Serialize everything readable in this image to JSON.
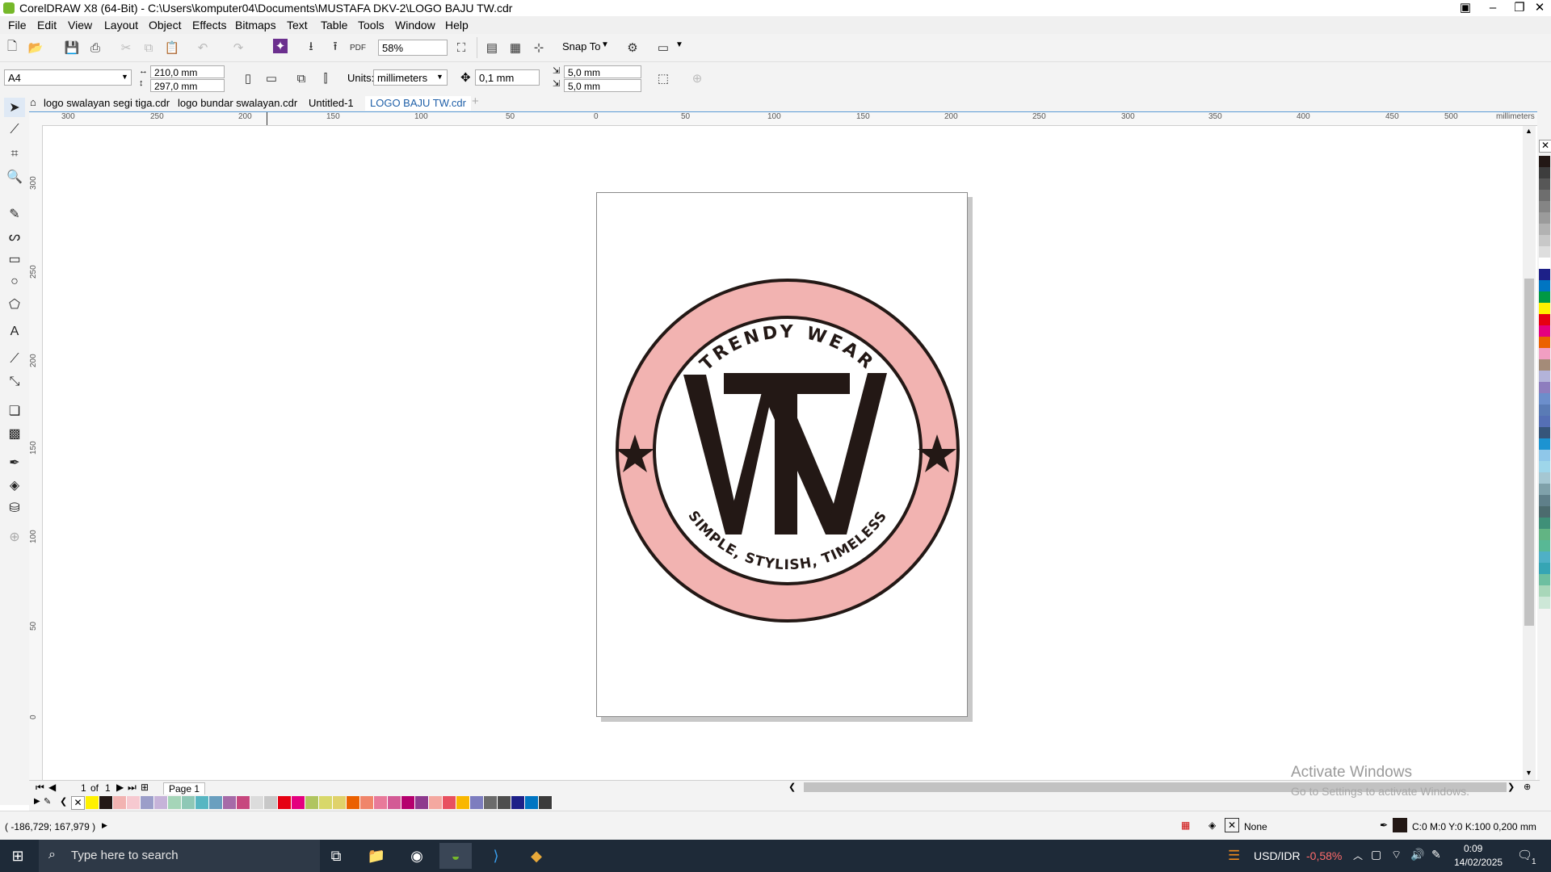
{
  "window": {
    "title": "CorelDRAW X8 (64-Bit) - C:\\Users\\komputer04\\Documents\\MUSTAFA DKV-2\\LOGO BAJU TW.cdr"
  },
  "menu": [
    "File",
    "Edit",
    "View",
    "Layout",
    "Object",
    "Effects",
    "Bitmaps",
    "Text",
    "Table",
    "Tools",
    "Window",
    "Help"
  ],
  "toolbar": {
    "zoom": "58%",
    "snap_to": "Snap To"
  },
  "property_bar": {
    "page_size": "A4",
    "width": "210,0 mm",
    "height": "297,0 mm",
    "units_label": "Units:",
    "units": "millimeters",
    "nudge": "0,1 mm",
    "dup_x": "5,0 mm",
    "dup_y": "5,0 mm"
  },
  "tabs": [
    "logo swalayan segi tiga.cdr",
    "logo bundar swalayan.cdr",
    "Untitled-1",
    "LOGO BAJU TW.cdr"
  ],
  "active_tab": "LOGO BAJU TW.cdr",
  "hruler": {
    "labels": [
      "300",
      "250",
      "200",
      "150",
      "100",
      "50",
      "0",
      "50",
      "100",
      "150",
      "200",
      "250",
      "300",
      "350",
      "400",
      "450",
      "500"
    ],
    "unit": "millimeters"
  },
  "vruler": {
    "labels": [
      "300",
      "250",
      "200",
      "150",
      "100",
      "50",
      "0"
    ]
  },
  "logo": {
    "top_text": "TRENDY WEAR",
    "bottom_text": "SIMPLE, STYLISH, TIMELESS",
    "ring_color": "#f2b3b1",
    "ink_color": "#231815"
  },
  "page_nav": {
    "page_index": "1",
    "of_label": "of",
    "page_count": "1",
    "page_tab": "Page 1"
  },
  "status": {
    "coords": "( -186,729; 167,979 )",
    "fill_label": "None",
    "outline_info": "C:0 M:0 Y:0 K:100  0,200 mm"
  },
  "watermark": {
    "line1": "Activate Windows",
    "line2": "Go to Settings to activate Windows."
  },
  "taskbar": {
    "search_placeholder": "Type here to search",
    "currency": "USD/IDR",
    "currency_change": "-0,58%",
    "time": "0:09",
    "date": "14/02/2025",
    "notification_count": "1"
  },
  "palette_right": [
    "#231815",
    "#3d3d3d",
    "#575757",
    "#6e6e6e",
    "#858585",
    "#9b9b9b",
    "#b2b2b2",
    "#c8c8c8",
    "#dedede",
    "#ffffff",
    "#1d2088",
    "#0075c2",
    "#009944",
    "#fff100",
    "#e60012",
    "#e4007f",
    "#eb6100",
    "#f19ec2",
    "#a48b78",
    "#b3b3d9",
    "#8e7dbe",
    "#6c8ecb",
    "#5a7bb5",
    "#556fb5",
    "#36557a",
    "#1c93d1",
    "#8fc7e9",
    "#9ed6ea",
    "#a5c7d2",
    "#7fa1aa",
    "#5f7f89",
    "#4c6b6e",
    "#3f9078",
    "#62b483",
    "#58b895",
    "#4fb0c6",
    "#36a5b4",
    "#6dbfa0",
    "#a8d7b9",
    "#cde7d7"
  ],
  "palette_bottom": [
    "#fff100",
    "#231815",
    "#f2b3b1",
    "#f6c9d0",
    "#9b9ec9",
    "#c6b3d9",
    "#a5d5b8",
    "#8fc8b6",
    "#57b6c2",
    "#6a9fbf",
    "#a66ba8",
    "#c7477e",
    "#dcdcdc",
    "#c8c8c8",
    "#e60012",
    "#e4007f",
    "#b0c560",
    "#d8d86a",
    "#e0d26a",
    "#eb6100",
    "#f0856a",
    "#e87a9a",
    "#d35b95",
    "#b5006e",
    "#8e3a8e",
    "#f4a8a0",
    "#e85060",
    "#f9b700",
    "#7d7dbf",
    "#6b6b6b",
    "#4e4e4e",
    "#1d2088",
    "#0075c2",
    "#3b3b3b"
  ]
}
